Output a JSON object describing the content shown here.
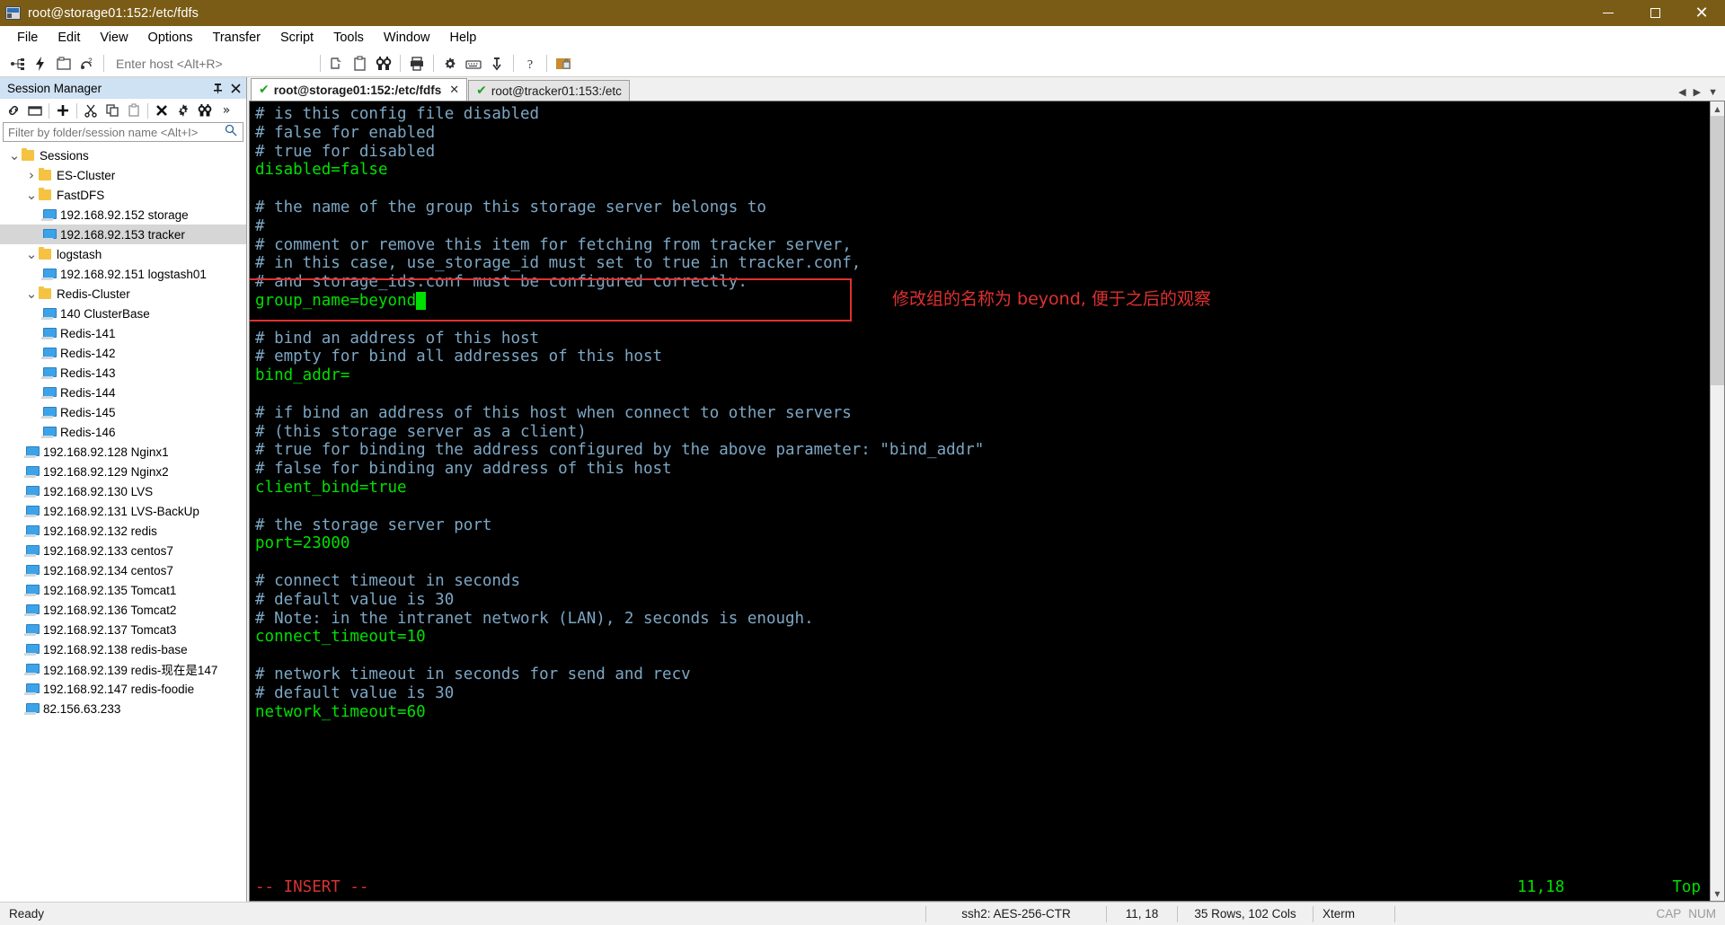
{
  "window": {
    "title": "root@storage01:152:/etc/fdfs",
    "app_icon": "securecrt-icon",
    "minimize": "minimize-icon",
    "maximize": "maximize-icon",
    "close": "close-icon"
  },
  "menubar": {
    "items": [
      "File",
      "Edit",
      "View",
      "Options",
      "Transfer",
      "Script",
      "Tools",
      "Window",
      "Help"
    ]
  },
  "toolbar": {
    "host_placeholder": "Enter host <Alt+R>",
    "host_value": "",
    "buttons": [
      {
        "name": "connect-icon"
      },
      {
        "name": "quick-connect-icon"
      },
      {
        "name": "connect-in-tab-icon"
      },
      {
        "name": "connect-sftp-icon"
      },
      {
        "name": "clone-session-icon"
      },
      {
        "name": "paste-icon"
      },
      {
        "name": "find-icon"
      },
      {
        "name": "print-icon"
      },
      {
        "name": "session-options-icon"
      },
      {
        "name": "keymap-editor-icon"
      },
      {
        "name": "transfer-icon"
      },
      {
        "name": "help-icon"
      },
      {
        "name": "lock-color-icon"
      }
    ]
  },
  "session_manager": {
    "title": "Session Manager",
    "pin": "pin-icon",
    "close": "close-icon",
    "toolbar": [
      {
        "name": "connect-link-icon"
      },
      {
        "name": "new-window-icon"
      },
      {
        "name": "new-session-icon"
      },
      {
        "name": "cut-icon"
      },
      {
        "name": "copy-icon"
      },
      {
        "name": "paste-icon"
      },
      {
        "name": "delete-icon"
      },
      {
        "name": "properties-icon"
      },
      {
        "name": "find-icon"
      },
      {
        "name": "overflow-icon"
      }
    ],
    "filter_placeholder": "Filter by folder/session name <Alt+I>",
    "filter_value": "",
    "search_icon": "search-icon",
    "tree": [
      {
        "label": "Sessions",
        "type": "folder",
        "depth": 0,
        "expand": "expanded",
        "selected": false
      },
      {
        "label": "ES-Cluster",
        "type": "folder",
        "depth": 1,
        "expand": "collapsed",
        "selected": false
      },
      {
        "label": "FastDFS",
        "type": "folder",
        "depth": 1,
        "expand": "expanded",
        "selected": false
      },
      {
        "label": "192.168.92.152 storage",
        "type": "session",
        "depth": 2,
        "expand": "none",
        "selected": false
      },
      {
        "label": "192.168.92.153 tracker",
        "type": "session",
        "depth": 2,
        "expand": "none",
        "selected": true
      },
      {
        "label": "logstash",
        "type": "folder",
        "depth": 1,
        "expand": "expanded",
        "selected": false
      },
      {
        "label": "192.168.92.151 logstash01",
        "type": "session",
        "depth": 2,
        "expand": "none",
        "selected": false
      },
      {
        "label": "Redis-Cluster",
        "type": "folder",
        "depth": 1,
        "expand": "expanded",
        "selected": false
      },
      {
        "label": "140 ClusterBase",
        "type": "session",
        "depth": 2,
        "expand": "none",
        "selected": false
      },
      {
        "label": "Redis-141",
        "type": "session",
        "depth": 2,
        "expand": "none",
        "selected": false
      },
      {
        "label": "Redis-142",
        "type": "session",
        "depth": 2,
        "expand": "none",
        "selected": false
      },
      {
        "label": "Redis-143",
        "type": "session",
        "depth": 2,
        "expand": "none",
        "selected": false
      },
      {
        "label": "Redis-144",
        "type": "session",
        "depth": 2,
        "expand": "none",
        "selected": false
      },
      {
        "label": "Redis-145",
        "type": "session",
        "depth": 2,
        "expand": "none",
        "selected": false
      },
      {
        "label": "Redis-146",
        "type": "session",
        "depth": 2,
        "expand": "none",
        "selected": false
      },
      {
        "label": "192.168.92.128 Nginx1",
        "type": "session",
        "depth": 1,
        "expand": "none",
        "selected": false
      },
      {
        "label": "192.168.92.129 Nginx2",
        "type": "session",
        "depth": 1,
        "expand": "none",
        "selected": false
      },
      {
        "label": "192.168.92.130 LVS",
        "type": "session",
        "depth": 1,
        "expand": "none",
        "selected": false
      },
      {
        "label": "192.168.92.131 LVS-BackUp",
        "type": "session",
        "depth": 1,
        "expand": "none",
        "selected": false
      },
      {
        "label": "192.168.92.132 redis",
        "type": "session",
        "depth": 1,
        "expand": "none",
        "selected": false
      },
      {
        "label": "192.168.92.133 centos7",
        "type": "session",
        "depth": 1,
        "expand": "none",
        "selected": false
      },
      {
        "label": "192.168.92.134 centos7",
        "type": "session",
        "depth": 1,
        "expand": "none",
        "selected": false
      },
      {
        "label": "192.168.92.135 Tomcat1",
        "type": "session",
        "depth": 1,
        "expand": "none",
        "selected": false
      },
      {
        "label": "192.168.92.136 Tomcat2",
        "type": "session",
        "depth": 1,
        "expand": "none",
        "selected": false
      },
      {
        "label": "192.168.92.137 Tomcat3",
        "type": "session",
        "depth": 1,
        "expand": "none",
        "selected": false
      },
      {
        "label": "192.168.92.138 redis-base",
        "type": "session",
        "depth": 1,
        "expand": "none",
        "selected": false
      },
      {
        "label": "192.168.92.139 redis-现在是147",
        "type": "session",
        "depth": 1,
        "expand": "none",
        "selected": false
      },
      {
        "label": "192.168.92.147 redis-foodie",
        "type": "session",
        "depth": 1,
        "expand": "none",
        "selected": false
      },
      {
        "label": "82.156.63.233",
        "type": "session",
        "depth": 1,
        "expand": "none",
        "selected": false
      }
    ]
  },
  "tabs": [
    {
      "label": "root@storage01:152:/etc/fdfs",
      "active": true,
      "check": "check-icon",
      "close": "close-icon"
    },
    {
      "label": "root@tracker01:153:/etc",
      "active": false,
      "check": "check-icon",
      "close": ""
    }
  ],
  "tab_nav": {
    "prev": "chevron-left-icon",
    "next": "chevron-right-icon",
    "down": "chevron-down-icon"
  },
  "terminal": {
    "lines": [
      {
        "text": "# is this config file disabled",
        "color": "comment"
      },
      {
        "text": "# false for enabled",
        "color": "comment"
      },
      {
        "text": "# true for disabled",
        "color": "comment"
      },
      {
        "text": "disabled=false",
        "color": "green"
      },
      {
        "text": "",
        "color": "comment"
      },
      {
        "text": "# the name of the group this storage server belongs to",
        "color": "comment"
      },
      {
        "text": "#",
        "color": "comment"
      },
      {
        "text": "# comment or remove this item for fetching from tracker server,",
        "color": "comment"
      },
      {
        "text": "# in this case, use_storage_id must set to true in tracker.conf,",
        "color": "comment"
      },
      {
        "text": "# and storage_ids.conf must be configured correctly.",
        "color": "comment"
      },
      {
        "text": "group_name=beyond",
        "color": "green",
        "cursor": true
      },
      {
        "text": "",
        "color": "comment"
      },
      {
        "text": "# bind an address of this host",
        "color": "comment"
      },
      {
        "text": "# empty for bind all addresses of this host",
        "color": "comment"
      },
      {
        "text": "bind_addr=",
        "color": "green"
      },
      {
        "text": "",
        "color": "comment"
      },
      {
        "text": "# if bind an address of this host when connect to other servers",
        "color": "comment"
      },
      {
        "text": "# (this storage server as a client)",
        "color": "comment"
      },
      {
        "text": "# true for binding the address configured by the above parameter: \"bind_addr\"",
        "color": "comment"
      },
      {
        "text": "# false for binding any address of this host",
        "color": "comment"
      },
      {
        "text": "client_bind=true",
        "color": "green"
      },
      {
        "text": "",
        "color": "comment"
      },
      {
        "text": "# the storage server port",
        "color": "comment"
      },
      {
        "text": "port=23000",
        "color": "green"
      },
      {
        "text": "",
        "color": "comment"
      },
      {
        "text": "# connect timeout in seconds",
        "color": "comment"
      },
      {
        "text": "# default value is 30",
        "color": "comment"
      },
      {
        "text": "# Note: in the intranet network (LAN), 2 seconds is enough.",
        "color": "comment"
      },
      {
        "text": "connect_timeout=10",
        "color": "green"
      },
      {
        "text": "",
        "color": "comment"
      },
      {
        "text": "# network timeout in seconds for send and recv",
        "color": "comment"
      },
      {
        "text": "# default value is 30",
        "color": "comment"
      },
      {
        "text": "network_timeout=60",
        "color": "green"
      }
    ],
    "vim_status": {
      "mode": "-- INSERT --",
      "position": "11,18",
      "scroll": "Top"
    }
  },
  "annotation": {
    "text": "修改组的名称为 beyond, 便于之后的观察",
    "color": "#e03030"
  },
  "statusbar": {
    "ready": "Ready",
    "encryption": "ssh2: AES-256-CTR",
    "position": "11, 18",
    "dimensions": "35 Rows, 102 Cols",
    "emulation": "Xterm",
    "caps": "CAP",
    "num": "NUM"
  }
}
